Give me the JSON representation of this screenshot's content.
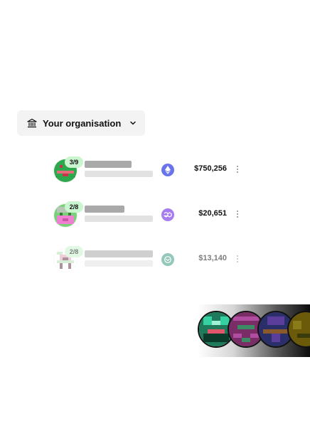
{
  "org_selector": {
    "label": "Your organisation",
    "icon": "bank-icon",
    "chevron_icon": "chevron-down-icon"
  },
  "accounts": [
    {
      "badge": "3/9",
      "network_icon": "ethereum-icon",
      "network_color": "#6a74ea",
      "amount": "$750,256",
      "avatar_colors": [
        "#2ea84d",
        "#c7354a",
        "#e56a7a"
      ]
    },
    {
      "badge": "2/8",
      "network_icon": "polygon-icon",
      "network_color": "#a67cf0",
      "amount": "$20,651",
      "avatar_colors": [
        "#7bd17a",
        "#ef7fd0",
        "#b7c7b5"
      ]
    },
    {
      "badge": "2/8",
      "network_icon": "gnosis-icon",
      "network_color": "#3c9b83",
      "amount": "$13,140",
      "avatar_colors": [
        "#b8e0b3",
        "#e3a7bb",
        "#6a3b4a"
      ]
    }
  ],
  "decorative_avatars": [
    {
      "name": "strip-avatar-green",
      "colors": [
        "#1f7a5c",
        "#35d1a3",
        "#0b3a2a"
      ]
    },
    {
      "name": "strip-avatar-purple",
      "colors": [
        "#7a2c66",
        "#b04da0",
        "#3c8a66"
      ]
    },
    {
      "name": "strip-avatar-navy",
      "colors": [
        "#2a2f6a",
        "#5b3d9c",
        "#8a5a2a"
      ]
    },
    {
      "name": "strip-avatar-olive",
      "colors": [
        "#6a5a0a",
        "#8a7a1a",
        "#3a3a0a"
      ]
    }
  ]
}
